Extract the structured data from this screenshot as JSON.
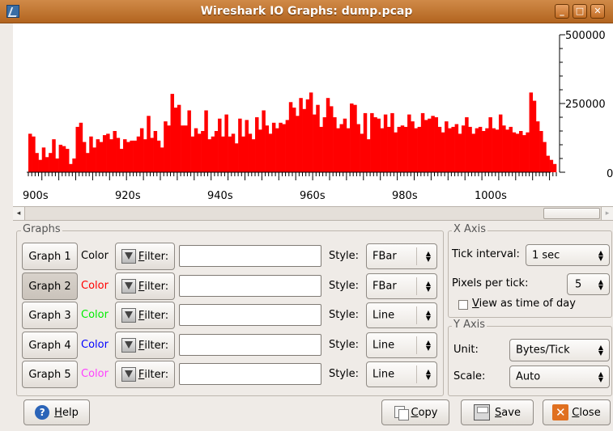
{
  "window": {
    "title": "Wireshark IO Graphs: dump.pcap",
    "controls": [
      "_",
      "□",
      "✕"
    ]
  },
  "chart_data": {
    "type": "bar",
    "y_ticks": [
      "500000",
      "250000",
      "0"
    ],
    "x_ticks": [
      "900s",
      "920s",
      "940s",
      "960s",
      "980s",
      "1000s"
    ],
    "ylim": [
      0,
      500000
    ],
    "x_start": 896,
    "series": [
      {
        "name": "Graph 2",
        "color": "#ff0000",
        "values": [
          140000,
          130000,
          70000,
          45000,
          90000,
          55000,
          70000,
          120000,
          50000,
          100000,
          95000,
          85000,
          30000,
          50000,
          165000,
          180000,
          110000,
          70000,
          130000,
          90000,
          120000,
          110000,
          135000,
          140000,
          120000,
          150000,
          125000,
          85000,
          120000,
          110000,
          115000,
          115000,
          130000,
          160000,
          120000,
          205000,
          125000,
          150000,
          115000,
          90000,
          185000,
          170000,
          285000,
          235000,
          245000,
          170000,
          170000,
          225000,
          130000,
          160000,
          140000,
          150000,
          225000,
          120000,
          130000,
          150000,
          195000,
          130000,
          210000,
          130000,
          140000,
          105000,
          195000,
          130000,
          190000,
          140000,
          120000,
          200000,
          155000,
          225000,
          170000,
          140000,
          180000,
          160000,
          180000,
          175000,
          190000,
          255000,
          235000,
          205000,
          270000,
          230000,
          265000,
          290000,
          210000,
          245000,
          165000,
          200000,
          270000,
          240000,
          200000,
          160000,
          175000,
          195000,
          160000,
          250000,
          245000,
          175000,
          140000,
          215000,
          120000,
          215000,
          200000,
          195000,
          160000,
          210000,
          165000,
          215000,
          145000,
          165000,
          170000,
          165000,
          210000,
          185000,
          160000,
          165000,
          215000,
          190000,
          195000,
          205000,
          200000,
          165000,
          145000,
          185000,
          160000,
          165000,
          175000,
          140000,
          170000,
          200000,
          165000,
          140000,
          160000,
          165000,
          150000,
          160000,
          200000,
          160000,
          155000,
          210000,
          170000,
          155000,
          165000,
          145000,
          140000,
          150000,
          135000,
          145000,
          290000,
          260000,
          185000,
          150000,
          110000,
          60000,
          45000,
          30000
        ]
      }
    ]
  },
  "scroll": {
    "left_arrow": "◂",
    "right_arrow": "▸"
  },
  "graphs": {
    "frame_label": "Graphs",
    "color_label": "Color",
    "filter_label": "Filter:",
    "filter_mnemonic": "F",
    "filter_rest": "ilter:",
    "style_label": "Style:",
    "rows": [
      {
        "button": "Graph 1",
        "color_hex": "#000000",
        "filter": "",
        "style": "FBar"
      },
      {
        "button": "Graph 2",
        "color_hex": "#ff0000",
        "filter": "",
        "style": "FBar"
      },
      {
        "button": "Graph 3",
        "color_hex": "#00ee00",
        "filter": "",
        "style": "Line"
      },
      {
        "button": "Graph 4",
        "color_hex": "#0000ff",
        "filter": "",
        "style": "Line"
      },
      {
        "button": "Graph 5",
        "color_hex": "#ff40ff",
        "filter": "",
        "style": "Line"
      }
    ]
  },
  "xaxis": {
    "frame_label": "X Axis",
    "tick_interval_label": "Tick interval:",
    "tick_interval_value": "1 sec",
    "pixels_per_tick_label": "Pixels per tick:",
    "pixels_per_tick_value": "5",
    "view_time_mnemonic": "V",
    "view_time_rest": "iew as time of day"
  },
  "yaxis": {
    "frame_label": "Y Axis",
    "unit_label": "Unit:",
    "unit_value": "Bytes/Tick",
    "scale_label": "Scale:",
    "scale_value": "Auto"
  },
  "buttons": {
    "help_mnemonic": "H",
    "help_rest": "elp",
    "copy_mnemonic": "C",
    "copy_rest": "opy",
    "save_mnemonic": "S",
    "save_rest": "ave",
    "close_mnemonic": "C",
    "close_rest": "lose"
  }
}
